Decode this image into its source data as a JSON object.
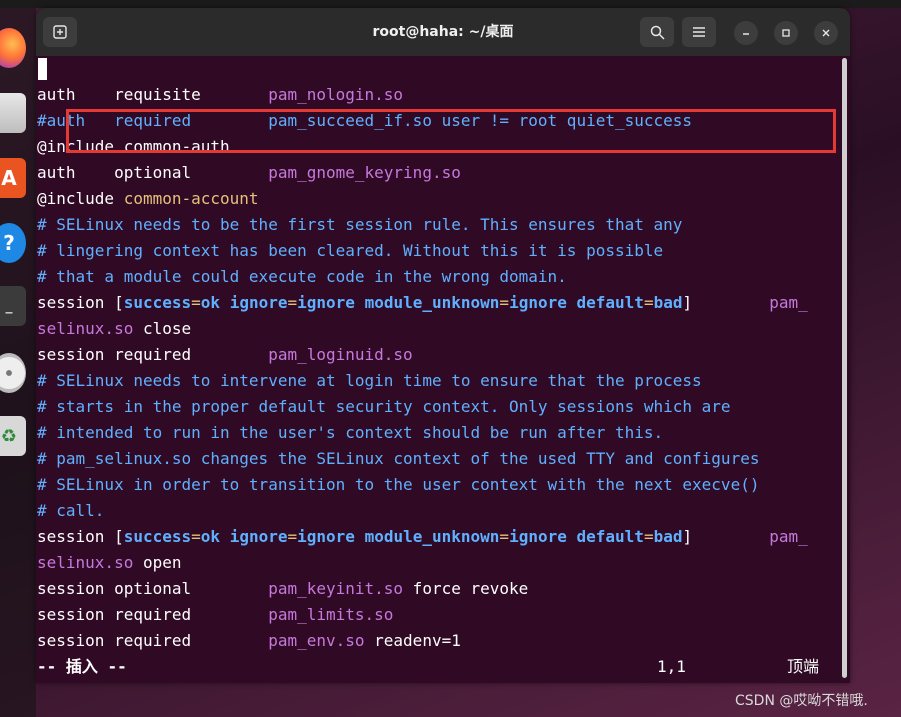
{
  "window": {
    "title": "root@haha: ~/桌面"
  },
  "dock": {
    "files_glyph": "",
    "store_glyph": "A",
    "help_glyph": "?",
    "trash_glyph": "♻"
  },
  "titlebar_icons": {
    "new_tab": "new-tab-icon",
    "search": "search-icon",
    "menu": "hamburger-menu-icon",
    "minimize": "minimize-icon",
    "maximize": "maximize-icon",
    "close": "close-icon"
  },
  "terminal": {
    "lines": [
      [],
      [
        [
          "auth    requisite       ",
          "k"
        ],
        [
          "pam_nologin.so",
          "m"
        ]
      ],
      [
        [
          "#auth   required        pam_succeed_if.so user != root quiet_success",
          "c"
        ]
      ],
      [
        [
          "@include ",
          "k"
        ],
        [
          "common-auth",
          "k"
        ]
      ],
      [
        [
          "auth    optional        ",
          "k"
        ],
        [
          "pam_gnome_keyring.so",
          "m"
        ]
      ],
      [
        [
          "@include ",
          "k"
        ],
        [
          "common-account",
          "y"
        ]
      ],
      [
        [
          "# SELinux needs to be the first session rule. This ensures that any",
          "c"
        ]
      ],
      [
        [
          "# lingering context has been cleared. Without this it is possible",
          "c"
        ]
      ],
      [
        [
          "# that a module could execute code in the wrong domain.",
          "c"
        ]
      ],
      [
        [
          "session [",
          "k"
        ],
        [
          "success",
          "b"
        ],
        [
          "=",
          "y"
        ],
        [
          "ok",
          "b"
        ],
        [
          " ",
          "k"
        ],
        [
          "ignore",
          "b"
        ],
        [
          "=",
          "y"
        ],
        [
          "ignore",
          "b"
        ],
        [
          " ",
          "k"
        ],
        [
          "module_unknown",
          "b"
        ],
        [
          "=",
          "y"
        ],
        [
          "ignore",
          "b"
        ],
        [
          " ",
          "k"
        ],
        [
          "default",
          "b"
        ],
        [
          "=",
          "y"
        ],
        [
          "bad",
          "b"
        ],
        [
          "]        ",
          "k"
        ],
        [
          "pam_",
          "m"
        ]
      ],
      [
        [
          "selinux.so",
          "m"
        ],
        [
          " close",
          "k"
        ]
      ],
      [
        [
          "session required        ",
          "k"
        ],
        [
          "pam_loginuid.so",
          "m"
        ]
      ],
      [
        [
          "# SELinux needs to intervene at login time to ensure that the process",
          "c"
        ]
      ],
      [
        [
          "# starts in the proper default security context. Only sessions which are",
          "c"
        ]
      ],
      [
        [
          "# intended to run in the user's context should be run after this.",
          "c"
        ]
      ],
      [
        [
          "# pam_selinux.so changes the SELinux context of the used TTY and configures",
          "c"
        ]
      ],
      [
        [
          "# SELinux in order to transition to the user context with the next execve()",
          "c"
        ]
      ],
      [
        [
          "# call.",
          "c"
        ]
      ],
      [
        [
          "session [",
          "k"
        ],
        [
          "success",
          "b"
        ],
        [
          "=",
          "y"
        ],
        [
          "ok",
          "b"
        ],
        [
          " ",
          "k"
        ],
        [
          "ignore",
          "b"
        ],
        [
          "=",
          "y"
        ],
        [
          "ignore",
          "b"
        ],
        [
          " ",
          "k"
        ],
        [
          "module_unknown",
          "b"
        ],
        [
          "=",
          "y"
        ],
        [
          "ignore",
          "b"
        ],
        [
          " ",
          "k"
        ],
        [
          "default",
          "b"
        ],
        [
          "=",
          "y"
        ],
        [
          "bad",
          "b"
        ],
        [
          "]        ",
          "k"
        ],
        [
          "pam_",
          "m"
        ]
      ],
      [
        [
          "selinux.so",
          "m"
        ],
        [
          " open",
          "k"
        ]
      ],
      [
        [
          "session optional        ",
          "k"
        ],
        [
          "pam_keyinit.so",
          "m"
        ],
        [
          " force revoke",
          "k"
        ]
      ],
      [
        [
          "session required        ",
          "k"
        ],
        [
          "pam_limits.so",
          "m"
        ]
      ],
      [
        [
          "session required        ",
          "k"
        ],
        [
          "pam_env.so",
          "m"
        ],
        [
          " readenv=1",
          "k"
        ]
      ]
    ],
    "status": {
      "mode": "-- 插入 --",
      "position": "1,1",
      "scroll": "顶端"
    }
  },
  "watermark": "CSDN @哎呦不错哦.",
  "colors": {
    "terminal_bg": "#300a24",
    "comment": "#5fb0ff",
    "module": "#c678dd",
    "keyword": "#5fb0ff",
    "operator": "#e5c07b",
    "highlight_box": "#e53935"
  }
}
